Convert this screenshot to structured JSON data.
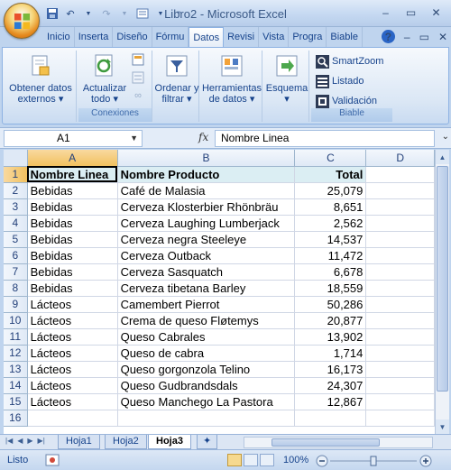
{
  "window": {
    "title": "Libro2 - Microsoft Excel"
  },
  "ribbon_tabs": [
    "Inicio",
    "Inserta",
    "Diseño",
    "Fórmu",
    "Datos",
    "Revisi",
    "Vista",
    "Progra",
    "Biable"
  ],
  "ribbon": {
    "obtener": "Obtener datos externos",
    "actualizar": "Actualizar todo",
    "conexiones_group": "Conexiones",
    "ordenar": "Ordenar y filtrar",
    "herramientas": "Herramientas de datos",
    "esquema": "Esquema",
    "smartzoom": "SmartZoom",
    "listado": "Listado",
    "validacion": "Validación",
    "biable_group": "Biable"
  },
  "formula_bar": {
    "cell_ref": "A1",
    "fx": "fx",
    "content": "Nombre Linea"
  },
  "columns": [
    "A",
    "B",
    "C",
    "D"
  ],
  "rows": [
    {
      "n": "1",
      "a": "Nombre Linea",
      "b": "Nombre Producto",
      "c": "Total"
    },
    {
      "n": "2",
      "a": "Bebidas",
      "b": "Café de Malasia",
      "c": "25,079"
    },
    {
      "n": "3",
      "a": "Bebidas",
      "b": "Cerveza Klosterbier Rhönbräu",
      "c": "8,651"
    },
    {
      "n": "4",
      "a": "Bebidas",
      "b": "Cerveza Laughing Lumberjack",
      "c": "2,562"
    },
    {
      "n": "5",
      "a": "Bebidas",
      "b": "Cerveza negra Steeleye",
      "c": "14,537"
    },
    {
      "n": "6",
      "a": "Bebidas",
      "b": "Cerveza Outback",
      "c": "11,472"
    },
    {
      "n": "7",
      "a": "Bebidas",
      "b": "Cerveza Sasquatch",
      "c": "6,678"
    },
    {
      "n": "8",
      "a": "Bebidas",
      "b": "Cerveza tibetana Barley",
      "c": "18,559"
    },
    {
      "n": "9",
      "a": "Lácteos",
      "b": "Camembert Pierrot",
      "c": "50,286"
    },
    {
      "n": "10",
      "a": "Lácteos",
      "b": "Crema de queso Fløtemys",
      "c": "20,877"
    },
    {
      "n": "11",
      "a": "Lácteos",
      "b": "Queso Cabrales",
      "c": "13,902"
    },
    {
      "n": "12",
      "a": "Lácteos",
      "b": "Queso de cabra",
      "c": "1,714"
    },
    {
      "n": "13",
      "a": "Lácteos",
      "b": "Queso gorgonzola Telino",
      "c": "16,173"
    },
    {
      "n": "14",
      "a": "Lácteos",
      "b": "Queso Gudbrandsdals",
      "c": "24,307"
    },
    {
      "n": "15",
      "a": "Lácteos",
      "b": "Queso Manchego La Pastora",
      "c": "12,867"
    },
    {
      "n": "16",
      "a": "",
      "b": "",
      "c": ""
    }
  ],
  "sheets": [
    "Hoja1",
    "Hoja2",
    "Hoja3"
  ],
  "active_sheet": "Hoja3",
  "status": {
    "mode": "Listo",
    "zoom": "100%"
  }
}
